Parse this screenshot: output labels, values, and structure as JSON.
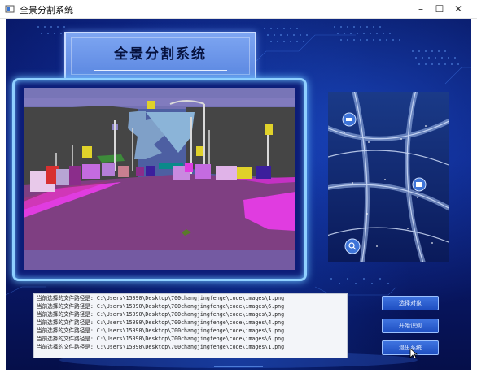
{
  "window": {
    "title": "全景分割系统",
    "controls": [
      "–",
      "☐",
      "✕"
    ]
  },
  "header": {
    "system_title": "全景分割系统"
  },
  "log": {
    "lines": [
      "当前选择的文件路径是: C:\\Users\\15090\\Desktop\\700changjingfenge\\code\\images\\1.png",
      "当前选择的文件路径是: C:\\Users\\15090\\Desktop\\700changjingfenge\\code\\images\\6.png",
      "当前选择的文件路径是: C:\\Users\\15090\\Desktop\\700changjingfenge\\code\\images\\3.png",
      "当前选择的文件路径是: C:\\Users\\15090\\Desktop\\700changjingfenge\\code\\images\\4.png",
      "当前选择的文件路径是: C:\\Users\\15090\\Desktop\\700changjingfenge\\code\\images\\5.png",
      "当前选择的文件路径是: C:\\Users\\15090\\Desktop\\700changjingfenge\\code\\images\\6.png",
      "当前选择的文件路径是: C:\\Users\\15090\\Desktop\\700changjingfenge\\code\\images\\1.png"
    ]
  },
  "buttons": {
    "select": "选择对象",
    "start": "开始识别",
    "exit": "退出系统"
  },
  "colors": {
    "accent": "#8fd0ff",
    "button": "#2b5fd0",
    "background": "#0a1c78"
  },
  "icons": [
    "car-icon",
    "vehicle-icon",
    "search-icon"
  ]
}
